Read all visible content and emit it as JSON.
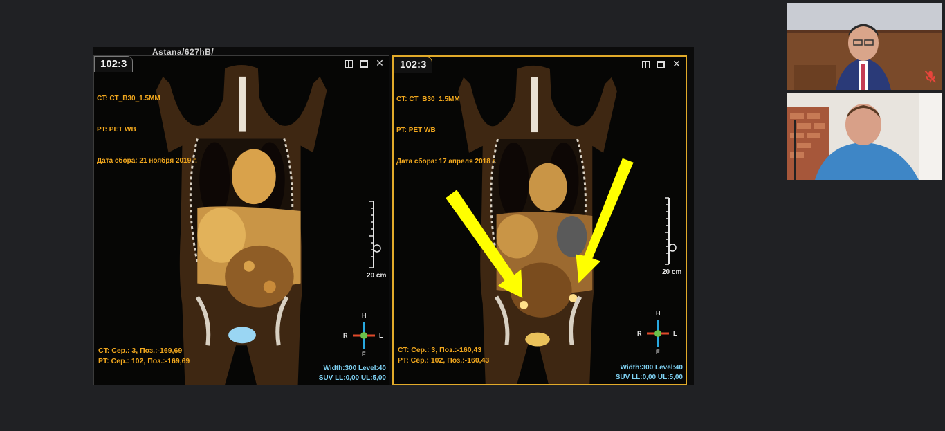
{
  "shared_screen": {
    "top_label": "Astana/627hB/",
    "panels": [
      {
        "tab": "102:3",
        "info_lines": [
          "CT: CT_B30_1.5MM",
          "PT: PET WB",
          "Дата сбора: 21 ноября 2019 г."
        ],
        "bottom_lines": [
          "CT: Сер.: 3, Поз.:-169,69",
          "PT: Сер.: 102, Поз.:-169,69"
        ],
        "wl_lines": [
          "Width:300 Level:40",
          "SUV LL:0,00 UL:5,00"
        ],
        "scale_label": "20 cm",
        "orient": {
          "h": "H",
          "f": "F",
          "r": "R",
          "l": "L"
        }
      },
      {
        "tab": "102:3",
        "info_lines": [
          "CT: CT_B30_1.5MM",
          "PT: PET WB",
          "Дата сбора: 17 апреля 2018 г."
        ],
        "bottom_lines": [
          "CT: Сер.: 3, Поз.:-160,43",
          "PT: Сер.: 102, Поз.:-160,43"
        ],
        "wl_lines": [
          "Width:300 Level:40",
          "SUV LL:0,00 UL:5,00"
        ],
        "scale_label": "20 cm",
        "orient": {
          "h": "H",
          "f": "F",
          "r": "R",
          "l": "L"
        }
      }
    ]
  },
  "icons": {
    "panel_controls": [
      "layout-icon",
      "maximize-icon",
      "close-icon"
    ],
    "mute": "microphone-off-icon"
  },
  "colors": {
    "background": "#202124",
    "overlay_text": "#f2a81e",
    "wl_text": "#7fd2f4",
    "active_border": "#e1aa2a",
    "arrow": "#ffff00",
    "mute": "#e8453c"
  }
}
